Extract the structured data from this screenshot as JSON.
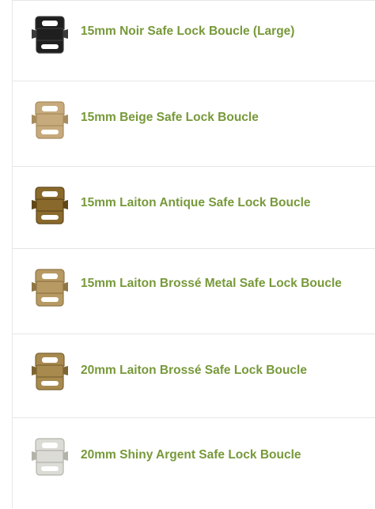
{
  "colors": {
    "link": "#77993a",
    "divider": "#e6e6e6"
  },
  "products": [
    {
      "title": "15mm Noir Safe Lock Boucle (Large)",
      "icon": "buckle-black-icon",
      "fill": "#1f1f1f",
      "shade": "#3a3a3a"
    },
    {
      "title": "15mm Beige Safe Lock Boucle",
      "icon": "buckle-beige-icon",
      "fill": "#c7aa7c",
      "shade": "#a88c5e"
    },
    {
      "title": "15mm Laiton Antique Safe Lock Boucle",
      "icon": "buckle-antique-brass-icon",
      "fill": "#8a6a2c",
      "shade": "#5f4718"
    },
    {
      "title": "15mm Laiton Brossé Metal Safe Lock Boucle",
      "icon": "buckle-brushed-brass-icon",
      "fill": "#b79a63",
      "shade": "#8f7645"
    },
    {
      "title": "20mm Laiton Brossé Safe Lock Boucle",
      "icon": "buckle-brushed-brass-icon",
      "fill": "#a88a4e",
      "shade": "#7d6533"
    },
    {
      "title": "20mm Shiny Argent Safe Lock Boucle",
      "icon": "buckle-silver-icon",
      "fill": "#dcdcd6",
      "shade": "#b3b3ab"
    }
  ]
}
